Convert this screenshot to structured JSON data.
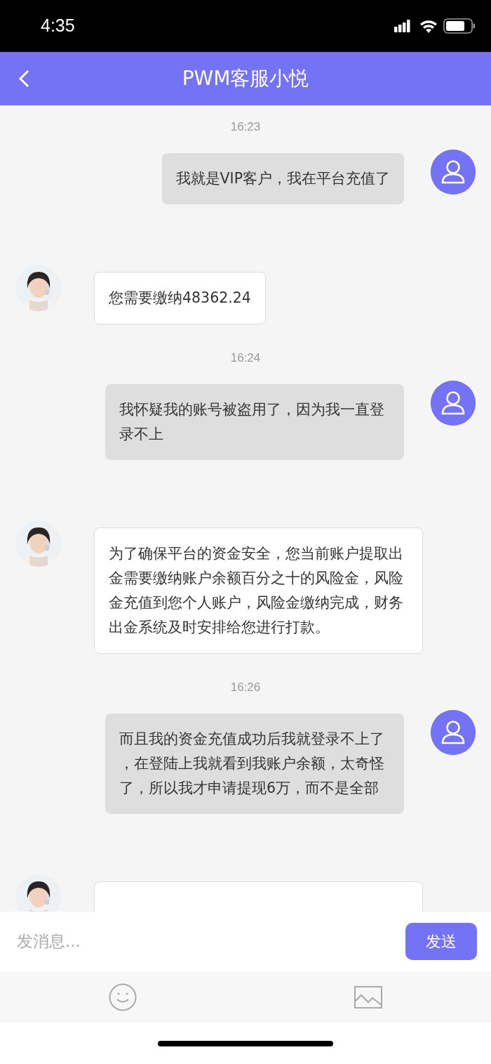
{
  "status_bar": {
    "time": "4:35"
  },
  "header": {
    "title": "PWM客服小悦"
  },
  "messages": [
    {
      "kind": "time",
      "text": "16:23"
    },
    {
      "kind": "sent",
      "text": "我就是VIP客户，我在平台充值了"
    },
    {
      "kind": "received",
      "text": "您需要缴纳48362.24"
    },
    {
      "kind": "time",
      "text": "16:24"
    },
    {
      "kind": "sent",
      "text": "我怀疑我的账号被盗用了，因为我一直登录不上"
    },
    {
      "kind": "received",
      "text": "为了确保平台的资金安全，您当前账户提取出金需要缴纳账户余额百分之十的风险金，风险金充值到您个人账户，风险金缴纳完成，财务出金系统及时安排给您进行打款。"
    },
    {
      "kind": "time",
      "text": "16:26"
    },
    {
      "kind": "sent",
      "text": "而且我的资金充值成功后我就登录不上了，在登陆上我就看到我账户余额，太奇怪了，所以我才申请提现6万，而不是全部"
    },
    {
      "kind": "received"
    }
  ],
  "composer": {
    "placeholder": "发消息...",
    "send_button": "发送"
  }
}
